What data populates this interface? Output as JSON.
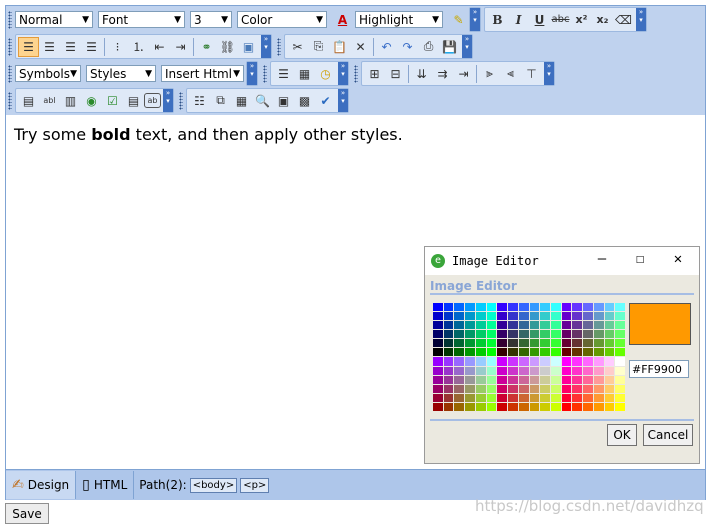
{
  "toolbar": {
    "row1": {
      "format": "Normal",
      "font": "Font",
      "size": "3",
      "color": "Color",
      "highlight": "Highlight"
    },
    "row3": {
      "symbols": "Symbols",
      "styles": "Styles",
      "insert_html": "Insert Html"
    },
    "format_buttons": {
      "bold": "B",
      "italic": "I",
      "underline": "U",
      "strike": "abc",
      "superscript": "x²",
      "subscript": "x₂"
    }
  },
  "content": {
    "before": "Try some ",
    "bold": "bold",
    "after": " text, and then apply other styles."
  },
  "statusbar": {
    "design_label": "Design",
    "html_label": "HTML",
    "path_label": "Path(2):",
    "tags": [
      "<body>",
      "<p>"
    ]
  },
  "save_label": "Save",
  "watermark": "https://blog.csdn.net/davidhzq",
  "dialog": {
    "title": "Image Editor",
    "header": "Image Editor",
    "hex_value": "#FF9900",
    "preview_color": "#FF9900",
    "ok_label": "OK",
    "cancel_label": "Cancel"
  }
}
